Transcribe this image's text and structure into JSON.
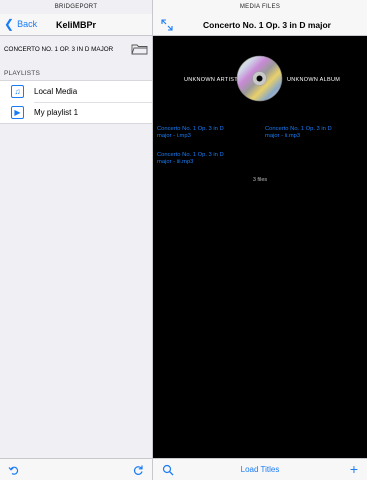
{
  "left_pane": {
    "status_label": "BRIDGEPORT",
    "nav": {
      "back_label": "Back",
      "title": "KeliMBPr"
    },
    "selected_folder": "CONCERTO NO. 1 OP. 3 IN D MAJOR",
    "section_header": "PLAYLISTS",
    "items": [
      {
        "label": "Local Media",
        "icon": "music-note-icon"
      },
      {
        "label": "My playlist 1",
        "icon": "play-icon"
      }
    ],
    "bottom": {
      "left_icon": "undo-icon",
      "right_icon": "refresh-icon"
    }
  },
  "right_pane": {
    "status_label": "MEDIA FILES",
    "nav": {
      "title": "Concerto No. 1 Op. 3 in D major",
      "left_icon": "expand-icon"
    },
    "album": {
      "artist": "UNKNOWN ARTIST",
      "album": "UNKNOWN ALBUM",
      "art_icon": "cd-icon"
    },
    "files": [
      {
        "name": "Concerto No. 1 Op. 3 in D major - i.mp3"
      },
      {
        "name": "Concerto No. 1 Op. 3 in D major - ii.mp3"
      },
      {
        "name": "Concerto No. 1 Op. 3 in D major - iii.mp3"
      }
    ],
    "count_label": "3 files",
    "bottom": {
      "load_label": "Load Titles",
      "left_icon": "search-icon",
      "right_icon": "plus-icon"
    }
  },
  "colors": {
    "accent": "#1a7cf5",
    "background_dark": "#000000",
    "pane_light": "#efeff4"
  }
}
